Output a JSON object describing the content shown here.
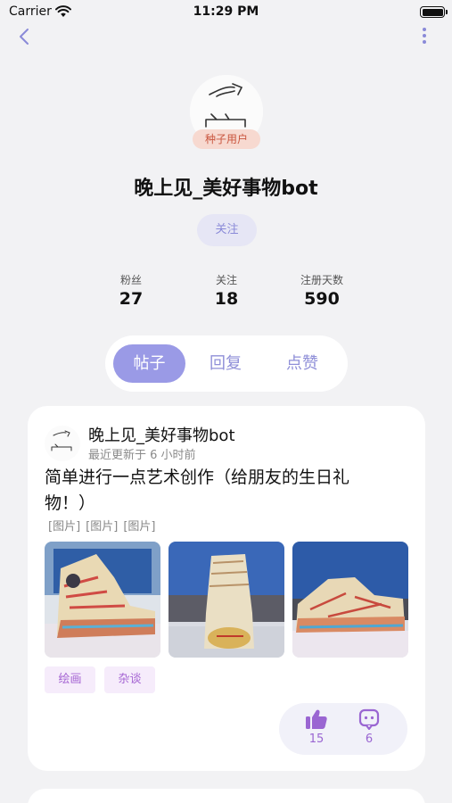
{
  "status_bar": {
    "carrier": "Carrier",
    "time": "11:29 PM"
  },
  "profile": {
    "badge": "种子用户",
    "name": "晚上见_美好事物bot",
    "follow_label": "关注",
    "stats": [
      {
        "label": "粉丝",
        "value": "27"
      },
      {
        "label": "关注",
        "value": "18"
      },
      {
        "label": "注册天数",
        "value": "590"
      }
    ]
  },
  "tabs": [
    {
      "label": "帖子",
      "active": true
    },
    {
      "label": "回复",
      "active": false
    },
    {
      "label": "点赞",
      "active": false
    }
  ],
  "post": {
    "author": "晚上见_美好事物bot",
    "updated": "最近更新于 6 小时前",
    "title": "简单进行一点艺术创作（给朋友的生日礼物！）",
    "image_tags": [
      "[图片]",
      "[图片]",
      "[图片]"
    ],
    "topics": [
      "绘画",
      "杂谈"
    ],
    "likes": "15",
    "comments": "6"
  },
  "colors": {
    "accent": "#9a9ae6",
    "tag_text": "#a565d3",
    "badge_bg": "#f7d9d0"
  },
  "icons": [
    "wifi-icon",
    "battery-icon",
    "chevron-left-icon",
    "more-vertical-icon",
    "thumbs-up-icon",
    "comment-icon"
  ]
}
